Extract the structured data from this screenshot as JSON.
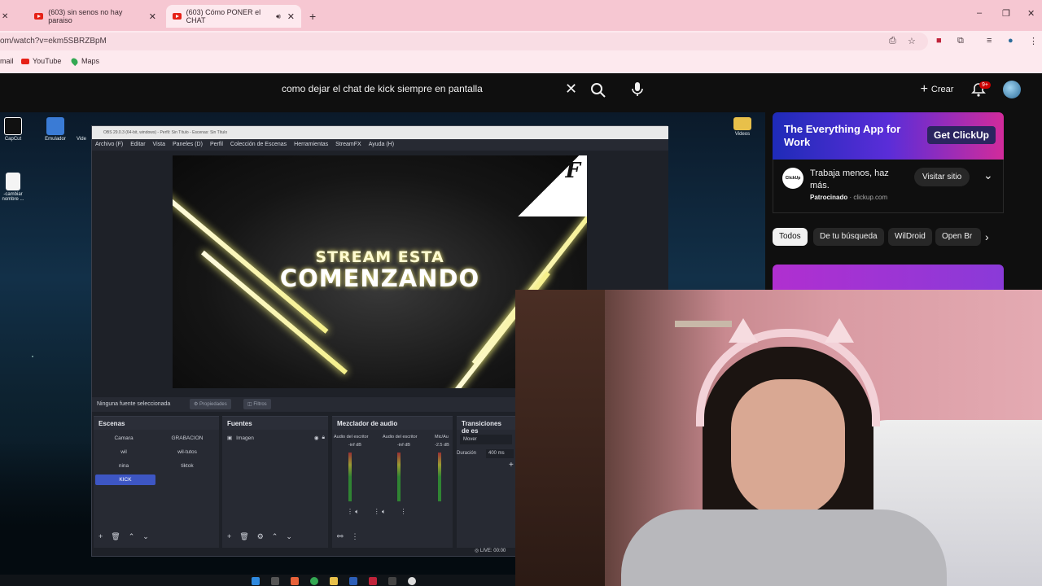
{
  "browser": {
    "tabs": [
      {
        "label": "(603) sin senos no hay paraiso",
        "active": false
      },
      {
        "label": "(603) Cómo PONER el CHAT",
        "active": true
      }
    ],
    "new_tab": "+",
    "url": "om/watch?v=ekm5SBRZBpM",
    "bookmarks": [
      {
        "label": "mail"
      },
      {
        "label": "YouTube"
      },
      {
        "label": "Maps"
      }
    ],
    "window_controls": {
      "minimize": "–",
      "maximize": "❐",
      "close": "✕"
    }
  },
  "youtube": {
    "search_value": "como dejar el chat de kick siempre en pantalla",
    "create_label": "Crear",
    "notifications_badge": "9+"
  },
  "desktop": {
    "icons": [
      {
        "label": "CapCut"
      },
      {
        "label": "Emulador"
      },
      {
        "label": "Vide"
      },
      {
        "label": "-cambiar nombre ..."
      },
      {
        "label": "Videos"
      }
    ]
  },
  "obs": {
    "title": "OBS 29.0.3 (64-bit, windows) - Perfil: Sin Título - Escenas: Sin Título",
    "menu": [
      "Archivo (F)",
      "Editar",
      "Vista",
      "Paneles (D)",
      "Perfil",
      "Colección de Escenas",
      "Herramientas",
      "StreamFX",
      "Ayuda (H)"
    ],
    "preview": {
      "line1": "STREAM ESTA",
      "line2": "COMENZANDO",
      "logo": "F"
    },
    "source_status": "Ninguna fuente seleccionada",
    "properties_button": "Propiedades",
    "filters_button": "Filtros",
    "docks": {
      "scenes": {
        "title": "Escenas",
        "items": [
          "Camara",
          "GRABACION",
          "wil",
          "wil-tutos",
          "nina",
          "tiktok",
          "KICK"
        ],
        "selected": "KICK"
      },
      "sources": {
        "title": "Fuentes",
        "items": [
          "Imagen"
        ]
      },
      "mixer": {
        "title": "Mezclador de audio",
        "channels": [
          "Audio del escritor",
          "Audio del escritor",
          "Mic/Au"
        ],
        "levels": [
          "-inf dB",
          "-inf dB",
          "-2.5 dB"
        ]
      },
      "transitions": {
        "title": "Transiciones de es",
        "type": "Mover",
        "duration_label": "Duración",
        "duration_value": "400 ms"
      }
    },
    "status": "LIVE: 00:00"
  },
  "sidebar": {
    "ad": {
      "headline": "The Everything App for Work",
      "cta": "Get ClickUp",
      "logo": "ClickUp",
      "text": "Trabaja menos, haz más.",
      "sponsored": "Patrocinado",
      "domain": "clickup.com",
      "visit_label": "Visitar sitio"
    },
    "chips": [
      {
        "label": "Todos",
        "active": true
      },
      {
        "label": "De tu búsqueda",
        "active": false
      },
      {
        "label": "WilDroid",
        "active": false
      },
      {
        "label": "Open Br",
        "active": false
      }
    ]
  },
  "colors": {
    "youtube_bg": "#0f0f0f",
    "tab_bar": "#f6c7d2",
    "obs_bg": "#1e2128",
    "scene_selected": "#3d56c4",
    "youtube_red": "#e62117"
  },
  "icons": [
    "youtube-icon",
    "maps-pin-icon",
    "search-icon",
    "clear-icon",
    "mic-icon",
    "plus-icon",
    "bell-icon",
    "avatar",
    "chevron-down-icon",
    "chevron-right-icon",
    "eye-icon",
    "lock-icon",
    "gear-icon"
  ]
}
